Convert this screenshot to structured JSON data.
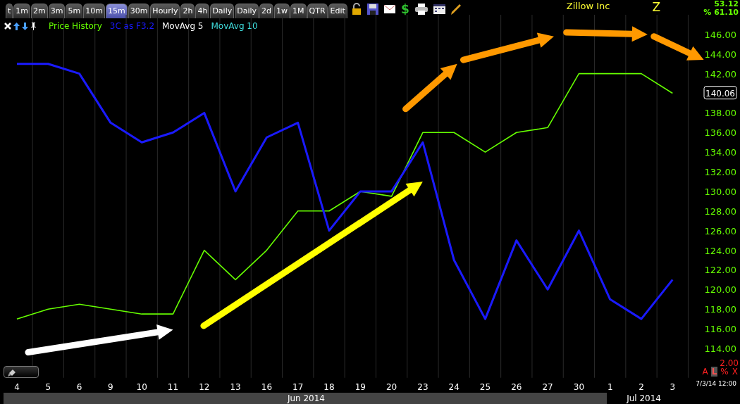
{
  "tabs": [
    {
      "label": "t",
      "selected": false
    },
    {
      "label": "1m",
      "selected": false
    },
    {
      "label": "2m",
      "selected": false
    },
    {
      "label": "3m",
      "selected": false
    },
    {
      "label": "5m",
      "selected": false
    },
    {
      "label": "10m",
      "selected": false
    },
    {
      "label": "15m",
      "selected": true
    },
    {
      "label": "30m",
      "selected": false
    },
    {
      "label": "Hourly",
      "selected": false
    },
    {
      "label": "2h",
      "selected": false
    },
    {
      "label": "4h",
      "selected": false
    },
    {
      "label": "Daily",
      "selected": false
    },
    {
      "label": "Daily",
      "selected": false
    },
    {
      "label": "2d",
      "selected": false
    },
    {
      "label": "1w",
      "selected": false
    },
    {
      "label": "1M",
      "selected": false
    },
    {
      "label": "QTR",
      "selected": false
    },
    {
      "label": "Edit",
      "selected": false
    }
  ],
  "toolbar": {
    "dollar": "$"
  },
  "symbol": {
    "name": "Zillow Inc",
    "ticker": "Z"
  },
  "stats": {
    "value": "53.12",
    "percent": "% 61.10"
  },
  "chart": {
    "chart_data": {
      "type": "line",
      "legend": "top-left",
      "categories": [
        "4",
        "5",
        "6",
        "9",
        "10",
        "11",
        "12",
        "13",
        "16",
        "17",
        "18",
        "19",
        "20",
        "23",
        "24",
        "25",
        "26",
        "27",
        "30",
        "1",
        "2",
        "3"
      ],
      "series": [
        {
          "name": "Price History",
          "color": "#66ff00",
          "values": [
            117,
            118,
            118.5,
            118,
            117.5,
            117.5,
            124,
            121,
            124,
            128,
            128,
            130,
            129.5,
            136,
            136,
            134,
            136,
            136.5,
            142,
            142,
            142,
            140
          ]
        },
        {
          "name": "3C as F3.2",
          "color": "#1a1aff",
          "values": [
            143,
            143,
            142,
            137,
            135,
            136,
            138,
            130,
            135.5,
            137,
            126,
            130,
            130,
            135,
            123,
            117,
            125,
            120,
            126,
            119,
            117,
            121
          ]
        }
      ],
      "ylim": [
        111,
        148
      ],
      "yticks": [
        {
          "value": 146,
          "label": "146.00"
        },
        {
          "value": 144,
          "label": "144.00"
        },
        {
          "value": 142,
          "label": "142.00"
        },
        {
          "value": 138,
          "label": "138.00"
        },
        {
          "value": 136,
          "label": "136.00"
        },
        {
          "value": 134,
          "label": "134.00"
        },
        {
          "value": 132,
          "label": "132.00"
        },
        {
          "value": 130,
          "label": "130.00"
        },
        {
          "value": 128,
          "label": "128.00"
        },
        {
          "value": 126,
          "label": "126.00"
        },
        {
          "value": 124,
          "label": "124.00"
        },
        {
          "value": 122,
          "label": "122.00"
        },
        {
          "value": 120,
          "label": "120.00"
        },
        {
          "value": 118,
          "label": "118.00"
        },
        {
          "value": 116,
          "label": "116.00"
        },
        {
          "value": 114,
          "label": "114.00"
        }
      ]
    },
    "indicators": [
      {
        "label": "MovAvg 5",
        "color": "#ffffff"
      },
      {
        "label": "MovAvg 10",
        "color": "#40e0e0"
      }
    ],
    "last_price": "140.06"
  },
  "scale": "2.00",
  "scale_buttons": [
    {
      "label": "A",
      "selected": false
    },
    {
      "label": "L",
      "selected": true
    },
    {
      "label": "%",
      "selected": false
    },
    {
      "label": "X",
      "selected": false
    }
  ],
  "timestamp": "7/3/14 12:00",
  "months": [
    {
      "label": "Jun 2014",
      "highlighted": true
    },
    {
      "label": "Jul 2014",
      "highlighted": false
    }
  ]
}
